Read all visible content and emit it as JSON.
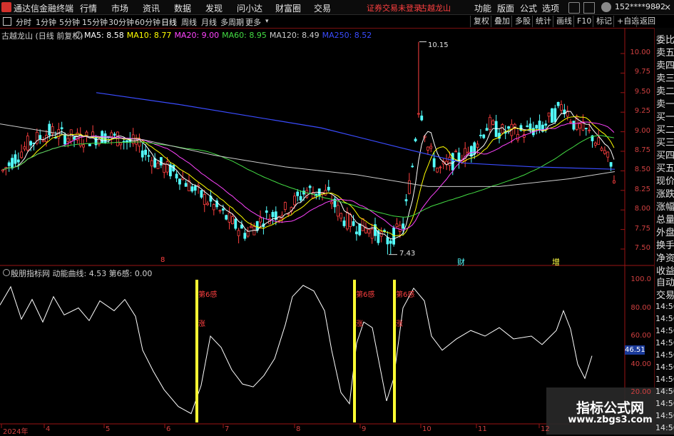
{
  "title_bar": {
    "app_name": "通达信金融终端",
    "menus": [
      "行情",
      "市场",
      "资讯",
      "数据",
      "发现",
      "问小达",
      "财富圈",
      "交易"
    ],
    "warning": "证券交易未登录",
    "stock_name": "古越龙山",
    "right_menus": [
      "功能",
      "版面",
      "公式",
      "选项"
    ],
    "user": "152****9892",
    "window_buttons": [
      "-",
      "□",
      "×"
    ]
  },
  "toolbar": {
    "periods": [
      "分时",
      "1分钟",
      "5分钟",
      "15分钟",
      "30分钟",
      "60分钟",
      "日线",
      "周线",
      "月线",
      "多周期",
      "更多"
    ],
    "active_period": "日线",
    "right_buttons": [
      "复权",
      "叠加",
      "多股",
      "统计",
      "画线",
      "F10",
      "标记",
      "+自选",
      "返回"
    ]
  },
  "main_chart": {
    "header": "古越龙山 (日线 前复权)",
    "ma_legend": [
      {
        "label": "MA5: 8.58",
        "color": "#ffffff"
      },
      {
        "label": "MA10: 8.77",
        "color": "#ffff00"
      },
      {
        "label": "MA20: 9.00",
        "color": "#ff44ff"
      },
      {
        "label": "MA60: 8.95",
        "color": "#44dd44"
      },
      {
        "label": "MA120: 8.49",
        "color": "#cccccc"
      },
      {
        "label": "MA250: 8.52",
        "color": "#3a4cff"
      }
    ],
    "price_axis": [
      "10.00",
      "9.75",
      "9.50",
      "9.25",
      "9.00",
      "8.75",
      "8.50",
      "8.25",
      "8.00",
      "7.75",
      "7.50"
    ],
    "high_label": "10.15",
    "low_label": "7.43",
    "event_markers": [
      "财",
      "增"
    ],
    "small_marker": "8"
  },
  "indicator": {
    "header": "殷朋指标网 动能曲线: 4.53 第6感: 0.00",
    "axis": [
      "100.0",
      "80.00",
      "60.00",
      "40.00",
      "20.00"
    ],
    "current_value": "46.51",
    "signal_text": "第6感",
    "signal_sub": "涨",
    "signal_count": 3
  },
  "x_axis": [
    "2024年",
    "4",
    "5",
    "6",
    "7",
    "8",
    "9",
    "10",
    "11",
    "12"
  ],
  "right_panel": {
    "top_labels": [
      "委比",
      "卖五",
      "卖四",
      "卖三",
      "卖二",
      "卖一",
      "买一",
      "买二",
      "买三",
      "买四",
      "买五",
      "现价",
      "涨跌",
      "涨幅",
      "总量",
      "外盘",
      "换手",
      "净资",
      "收益"
    ],
    "bottom_labels": [
      "自动",
      "交易"
    ],
    "times": [
      "14:56",
      "14:56",
      "14:56",
      "14:56",
      "14:56",
      "14:56",
      "14:56",
      "14:56",
      "14:56",
      "14:56",
      "14:56"
    ]
  },
  "watermark": {
    "title": "指标公式网",
    "url": "www.zbgs3.com"
  },
  "colors": {
    "up": "#ff4040",
    "down": "#54ffff",
    "background": "#000000",
    "grid": "#7a1010"
  }
}
